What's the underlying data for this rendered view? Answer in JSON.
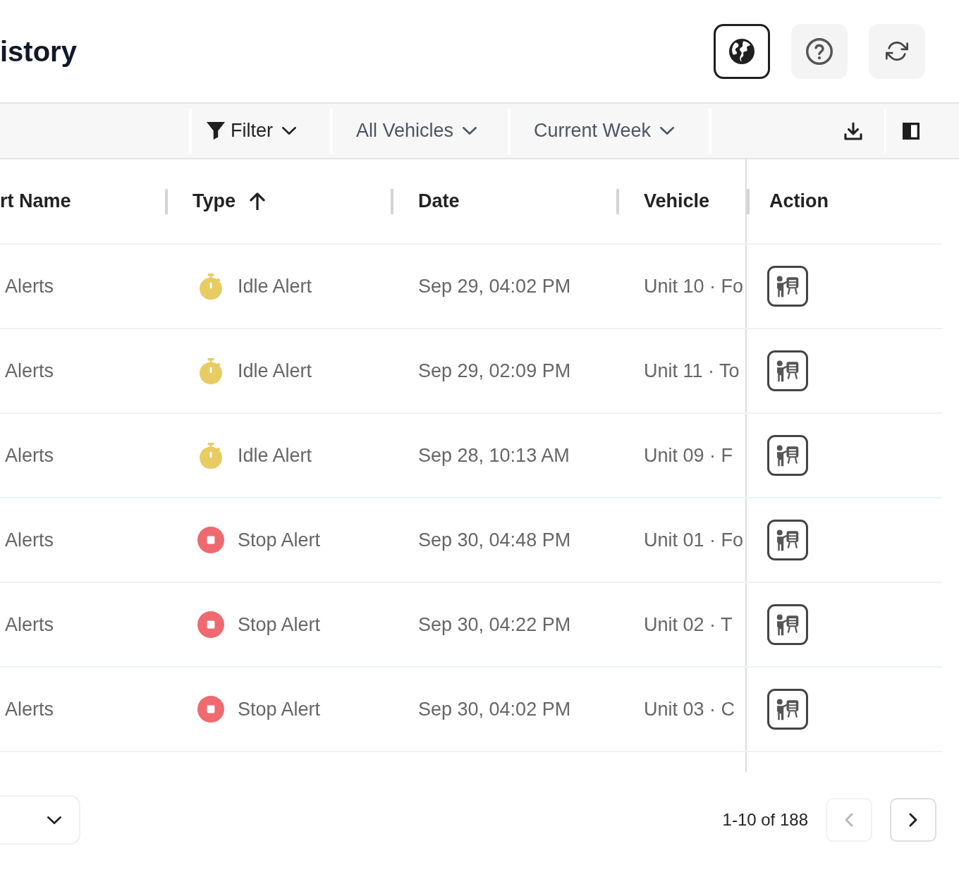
{
  "page": {
    "title": "istory"
  },
  "header_buttons": [
    {
      "active": true
    },
    {
      "active": false
    },
    {
      "active": false
    }
  ],
  "toolbar": {
    "filters": [
      {
        "label": "Filter",
        "kind": "filter"
      },
      {
        "label": "All Vehicles",
        "kind": "dropdown"
      },
      {
        "label": "Current Week",
        "kind": "dropdown"
      }
    ]
  },
  "table": {
    "columns": [
      {
        "label": "rt Name",
        "sorted_ascending": false
      },
      {
        "label": "Type",
        "sorted_ascending": true
      },
      {
        "label": "Date",
        "sorted_ascending": false
      },
      {
        "label": "Vehicle",
        "sorted_ascending": false
      },
      {
        "label": "Action",
        "sorted_ascending": false
      }
    ],
    "rows": [
      {
        "name": "Alerts",
        "type": {
          "label": "Idle Alert",
          "kind": "idle",
          "color": "#e8cb62"
        },
        "date": "Sep 29, 04:02 PM",
        "vehicle": "Unit 10 · Fo"
      },
      {
        "name": "Alerts",
        "type": {
          "label": "Idle Alert",
          "kind": "idle",
          "color": "#e8cb62"
        },
        "date": "Sep 29, 02:09 PM",
        "vehicle": "Unit 11 · To"
      },
      {
        "name": "Alerts",
        "type": {
          "label": "Idle Alert",
          "kind": "idle",
          "color": "#e8cb62"
        },
        "date": "Sep 28, 10:13 AM",
        "vehicle": "Unit 09 · F"
      },
      {
        "name": "Alerts",
        "type": {
          "label": "Stop Alert",
          "kind": "stop",
          "color": "#ee6a70"
        },
        "date": "Sep 30, 04:48 PM",
        "vehicle": "Unit 01 · Fo"
      },
      {
        "name": "Alerts",
        "type": {
          "label": "Stop Alert",
          "kind": "stop",
          "color": "#ee6a70"
        },
        "date": "Sep 30, 04:22 PM",
        "vehicle": "Unit 02 · T"
      },
      {
        "name": "Alerts",
        "type": {
          "label": "Stop Alert",
          "kind": "stop",
          "color": "#ee6a70"
        },
        "date": "Sep 30, 04:02 PM",
        "vehicle": "Unit 03 · C"
      }
    ]
  },
  "pagination": {
    "range": "1-10 of 188",
    "prev_disabled": true,
    "next_disabled": false
  }
}
